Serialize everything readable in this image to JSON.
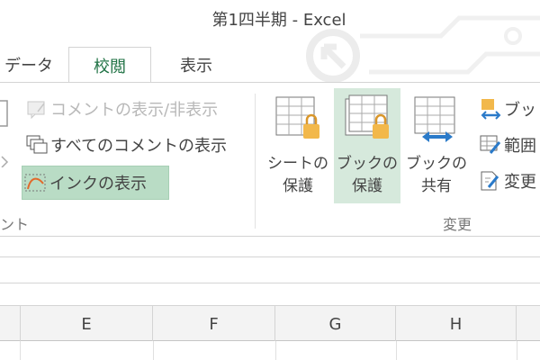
{
  "window": {
    "title": "第1四半期 - Excel"
  },
  "tabs": {
    "data": "データ",
    "review": "校閲",
    "view": "表示"
  },
  "ribbon": {
    "comments": {
      "show_comment": "コメントの表示/非表示",
      "show_all_comments": "すべてのコメントの表示",
      "show_ink": "インクの表示",
      "group_label": "ント"
    },
    "changes": {
      "protect_sheet": [
        "シートの",
        "保護"
      ],
      "protect_workbook": [
        "ブックの",
        "保護"
      ],
      "share_workbook": [
        "ブックの",
        "共有"
      ],
      "small1": "ブッ",
      "small2": "範囲",
      "small3": "変更",
      "group_label": "変更"
    }
  },
  "grid": {
    "columns": [
      "E",
      "F",
      "G",
      "H"
    ]
  },
  "colors": {
    "accent": "#217346",
    "active_fill": "#b9dcc5",
    "lock": "#f2b84b",
    "share_arrow": "#2a7ac9"
  },
  "icons": [
    "comment-icon",
    "all-comments-icon",
    "ink-icon",
    "protect-sheet-icon",
    "protect-workbook-icon",
    "share-workbook-icon",
    "allow-edit-icon",
    "range-icon",
    "track-changes-icon"
  ]
}
